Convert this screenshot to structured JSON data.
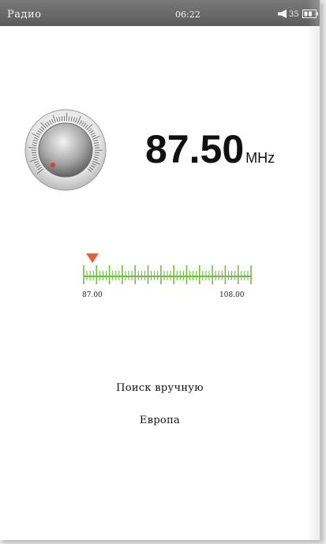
{
  "statusbar": {
    "app_title": "Радио",
    "time": "06:22",
    "volume_icon": "speaker-icon",
    "volume_level": "35",
    "battery_icon": "battery-icon"
  },
  "tuner": {
    "knob_icon": "tuning-knob-icon",
    "frequency": "87.50",
    "unit": "MHz",
    "scale_min": "87.00",
    "scale_max": "108.00",
    "tuned_fraction": 0.0238
  },
  "menu": {
    "manual_search": "Поиск вручную",
    "region": "Европа"
  },
  "colors": {
    "scale_green": "#6fbf3f",
    "marker_orange": "#e8603a",
    "knob_dot": "#e23b2a",
    "statusbar": "#666666"
  }
}
